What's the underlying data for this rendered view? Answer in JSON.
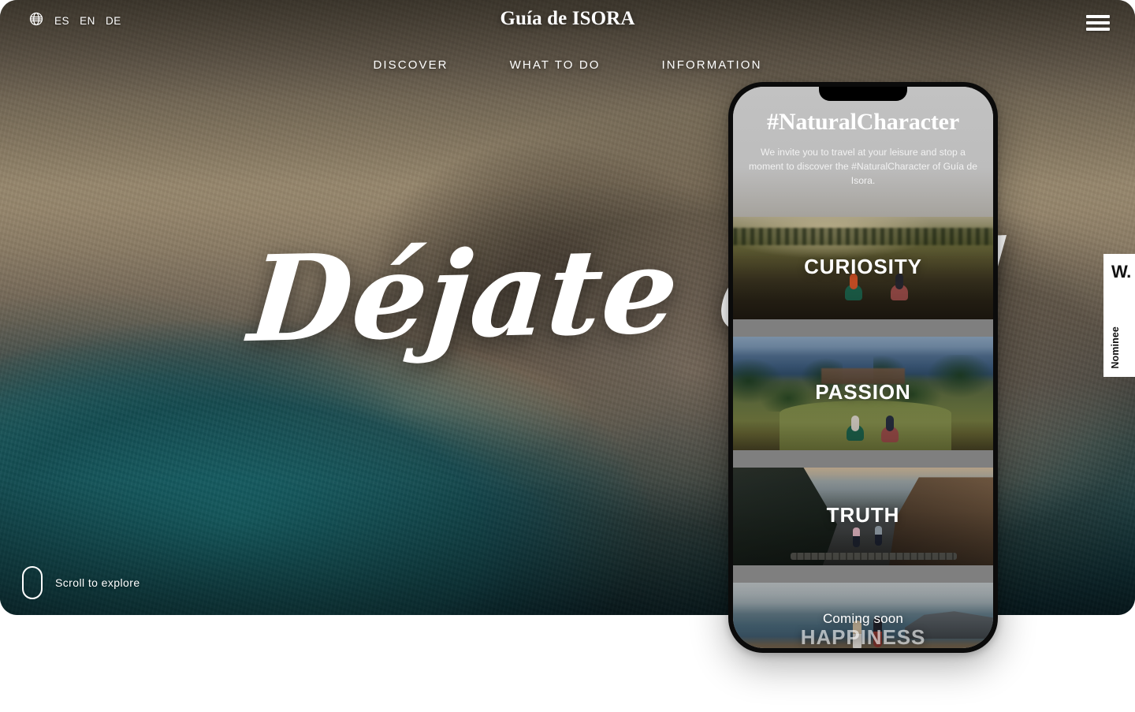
{
  "topbar": {
    "globe_icon": "globe-icon",
    "languages": [
      {
        "code": "ES"
      },
      {
        "code": "EN"
      },
      {
        "code": "DE"
      }
    ],
    "brand_title": "Guía de ISORA",
    "menu_icon": "hamburger-menu-icon"
  },
  "nav": {
    "items": [
      {
        "label": "DISCOVER"
      },
      {
        "label": "WHAT TO DO"
      },
      {
        "label": "INFORMATION"
      }
    ]
  },
  "hero": {
    "script_headline": "Déjate cuid",
    "scroll_hint": "Scroll to explore",
    "scroll_icon": "mouse-scroll-icon"
  },
  "award_badge": {
    "top_text": "W.",
    "rotated_text": "Nominee"
  },
  "phone": {
    "hashtag": "#NaturalCharacter",
    "intro_text": "We invite you to travel at your leisure and stop a moment to discover the #NaturalCharacter of Guía de Isora.",
    "cards": [
      {
        "label": "CURIOSITY",
        "coming_soon": "",
        "dim": false
      },
      {
        "label": "PASSION",
        "coming_soon": "",
        "dim": false
      },
      {
        "label": "TRUTH",
        "coming_soon": "",
        "dim": false
      },
      {
        "label": "HAPPINESS",
        "coming_soon": "Coming soon",
        "dim": true
      }
    ]
  },
  "colors": {
    "page_background": "#ffffff",
    "text_on_media": "#ffffff",
    "card_gap": "#7f7f7f",
    "phone_frame": "#0b0b0b",
    "badge_background": "#ffffff"
  }
}
